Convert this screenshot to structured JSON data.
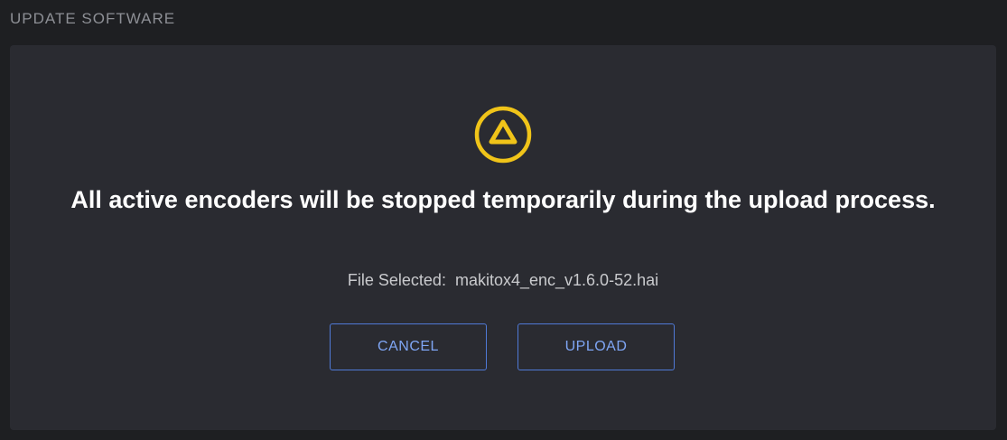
{
  "header": {
    "title": "UPDATE SOFTWARE"
  },
  "dialog": {
    "icon": "warning-triangle-icon",
    "accent_color": "#f0c419",
    "message": "All active encoders will be stopped temporarily during the upload process.",
    "file_label": "File Selected:",
    "file_name": "makitox4_enc_v1.6.0-52.hai",
    "cancel_label": "CANCEL",
    "upload_label": "UPLOAD",
    "button_color": "#7fa6f5"
  }
}
